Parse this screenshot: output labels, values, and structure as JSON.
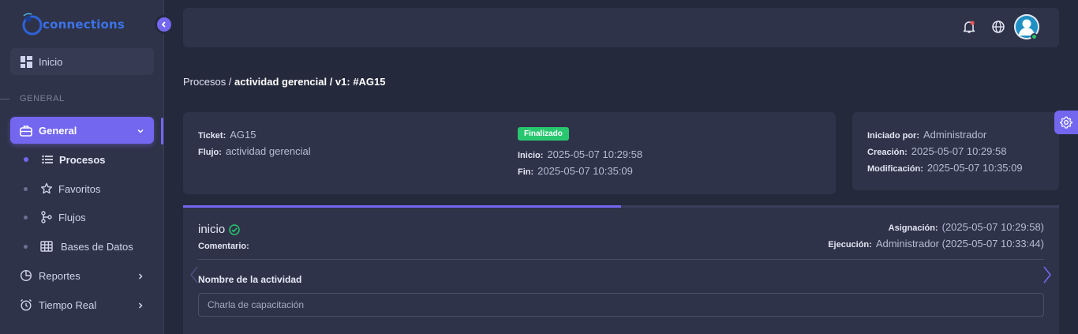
{
  "app": {
    "logo_text": "connections"
  },
  "sidebar": {
    "home_label": "Inicio",
    "section_label": "GENERAL",
    "group_label": "General",
    "sub_items": [
      {
        "label": "Procesos",
        "icon": "list-icon",
        "active": true
      },
      {
        "label": "Favoritos",
        "icon": "star-icon",
        "active": false
      },
      {
        "label": "Flujos",
        "icon": "flow-icon",
        "active": false
      },
      {
        "label": "Bases de Datos",
        "icon": "table-icon",
        "active": false
      }
    ],
    "items": [
      {
        "label": "Reportes",
        "icon": "pie-chart-icon"
      },
      {
        "label": "Tiempo Real",
        "icon": "alarm-clock-icon"
      }
    ]
  },
  "breadcrumb": {
    "root": "Procesos / ",
    "path": "actividad gerencial / v1: #AG15"
  },
  "ticket_card": {
    "ticket_key": "Ticket:",
    "ticket_val": "AG15",
    "flujo_key": "Flujo:",
    "flujo_val": "actividad gerencial",
    "status": "Finalizado",
    "inicio_key": "Inicio:",
    "inicio_val": "2025-05-07 10:29:58",
    "fin_key": "Fin:",
    "fin_val": "2025-05-07 10:35:09"
  },
  "meta_card": {
    "iniciado_key": "Iniciado por:",
    "iniciado_val": "Administrador",
    "creacion_key": "Creación:",
    "creacion_val": "2025-05-07 10:29:58",
    "modificacion_key": "Modificación:",
    "modificacion_val": "2025-05-07 10:35:09"
  },
  "activity": {
    "progress_fraction": 0.5,
    "title": "inicio",
    "comentario_key": "Comentario:",
    "asignacion_key": "Asignación:",
    "asignacion_val": "(2025-05-07 10:29:58)",
    "ejecucion_key": "Ejecución:",
    "ejecucion_val": "Administrador (2025-05-07 10:33:44)",
    "field_label": "Nombre de la actividad",
    "field_value": "Charla de capacitación"
  },
  "colors": {
    "primary": "#7367f0",
    "success": "#28c76f",
    "card_bg": "#2f3349",
    "page_bg": "#25293c",
    "notification": "#ea5455"
  }
}
